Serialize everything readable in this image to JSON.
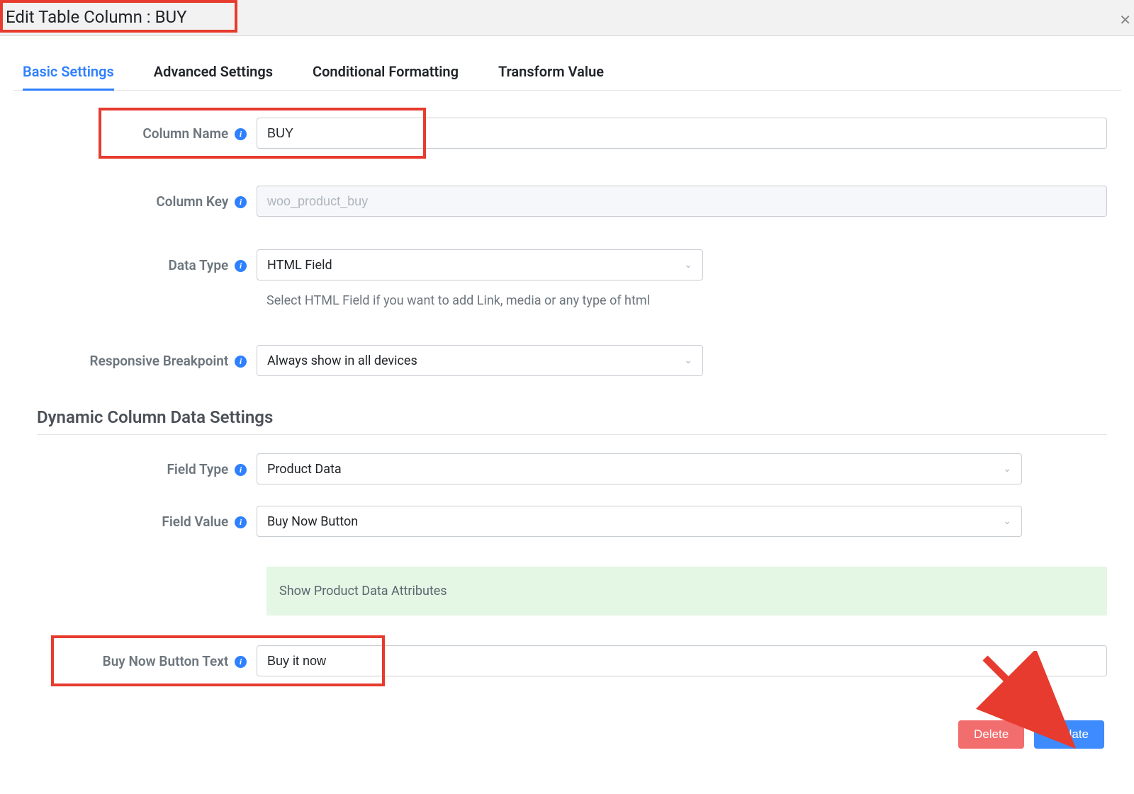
{
  "header": {
    "title": "Edit Table Column : BUY"
  },
  "tabs": {
    "basic": "Basic Settings",
    "advanced": "Advanced Settings",
    "conditional": "Conditional Formatting",
    "transform": "Transform Value"
  },
  "labels": {
    "column_name": "Column Name",
    "column_key": "Column Key",
    "data_type": "Data Type",
    "responsive": "Responsive Breakpoint",
    "field_type": "Field Type",
    "field_value": "Field Value",
    "buy_now_text": "Buy Now Button Text"
  },
  "values": {
    "column_name": "BUY",
    "column_key": "woo_product_buy",
    "data_type": "HTML Field",
    "responsive": "Always show in all devices",
    "field_type": "Product Data",
    "field_value": "Buy Now Button",
    "buy_now_text": "Buy it now"
  },
  "help": {
    "data_type": "Select HTML Field if you want to add Link, media or any type of html"
  },
  "section": {
    "dynamic": "Dynamic Column Data Settings",
    "attributes_panel": "Show Product Data Attributes"
  },
  "buttons": {
    "delete": "Delete",
    "update": "Update"
  }
}
